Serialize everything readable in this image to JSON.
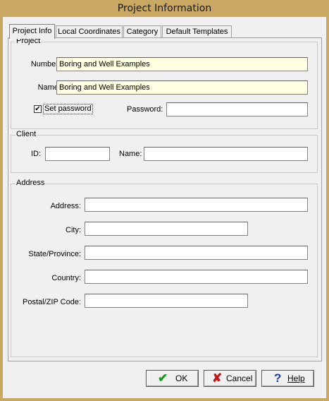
{
  "window": {
    "title": "Project Information"
  },
  "tabs": [
    "Project Info",
    "Local Coordinates",
    "Category",
    "Default Templates"
  ],
  "project": {
    "group_label": "Project",
    "number_label": "Number:",
    "number_value": "Boring and Well Examples",
    "name_label": "Name:",
    "name_value": "Boring and Well Examples",
    "set_password_label": "Set password",
    "set_password_checked": true,
    "password_label": "Password:",
    "password_value": ""
  },
  "client": {
    "group_label": "Client",
    "id_label": "ID:",
    "id_value": "",
    "name_label": "Name:",
    "name_value": ""
  },
  "address": {
    "group_label": "Address",
    "address_label": "Address:",
    "address_value": "",
    "city_label": "City:",
    "city_value": "",
    "state_label": "State/Province:",
    "state_value": "",
    "country_label": "Country:",
    "country_value": "",
    "postal_label": "Postal/ZIP Code:",
    "postal_value": ""
  },
  "buttons": {
    "ok_label": "OK",
    "cancel_label": "Cancel",
    "help_label": "Help"
  },
  "icons": {
    "ok": "checkmark-icon",
    "cancel": "x-icon",
    "help": "question-icon"
  },
  "colors": {
    "frame": "#c8a863",
    "highlight_field": "#ffffe1",
    "ok_icon": "#1a9a1a",
    "cancel_icon": "#c01818",
    "help_icon": "#1a3aa8"
  }
}
